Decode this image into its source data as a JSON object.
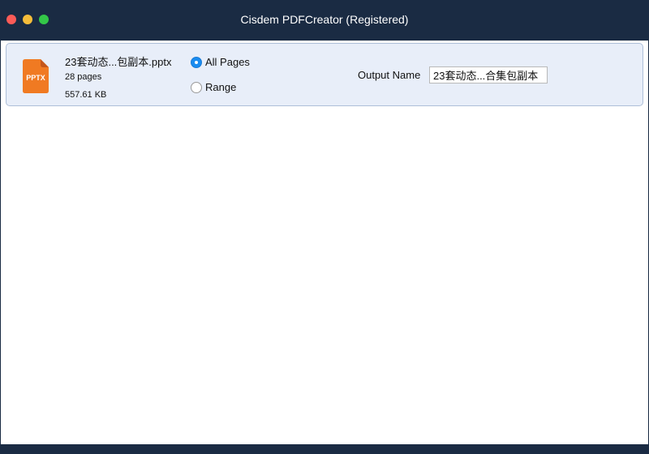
{
  "window": {
    "title": "Cisdem PDFCreator (Registered)"
  },
  "file": {
    "icon_label": "PPTX",
    "icon_color": "#f07a22",
    "name": "23套动态...包副本.pptx",
    "pages": "28 pages",
    "size": "557.61 KB"
  },
  "page_options": {
    "all_pages_label": "All Pages",
    "range_label": "Range",
    "selected": "All Pages"
  },
  "output": {
    "label": "Output Name",
    "value": "23套动态...合集包副本"
  }
}
